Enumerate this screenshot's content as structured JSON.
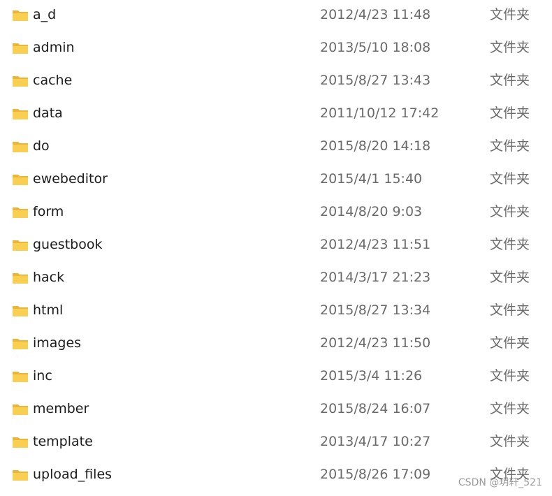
{
  "files": [
    {
      "name": "a_d",
      "modified": "2012/4/23 11:48",
      "type": "文件夹",
      "icon": "folder-icon"
    },
    {
      "name": "admin",
      "modified": "2013/5/10 18:08",
      "type": "文件夹",
      "icon": "folder-icon"
    },
    {
      "name": "cache",
      "modified": "2015/8/27 13:43",
      "type": "文件夹",
      "icon": "folder-icon"
    },
    {
      "name": "data",
      "modified": "2011/10/12 17:42",
      "type": "文件夹",
      "icon": "folder-icon"
    },
    {
      "name": "do",
      "modified": "2015/8/20 14:18",
      "type": "文件夹",
      "icon": "folder-icon"
    },
    {
      "name": "ewebeditor",
      "modified": "2015/4/1 15:40",
      "type": "文件夹",
      "icon": "folder-icon"
    },
    {
      "name": "form",
      "modified": "2014/8/20 9:03",
      "type": "文件夹",
      "icon": "folder-icon"
    },
    {
      "name": "guestbook",
      "modified": "2012/4/23 11:51",
      "type": "文件夹",
      "icon": "folder-icon"
    },
    {
      "name": "hack",
      "modified": "2014/3/17 21:23",
      "type": "文件夹",
      "icon": "folder-icon"
    },
    {
      "name": "html",
      "modified": "2015/8/27 13:34",
      "type": "文件夹",
      "icon": "folder-icon"
    },
    {
      "name": "images",
      "modified": "2012/4/23 11:50",
      "type": "文件夹",
      "icon": "folder-icon"
    },
    {
      "name": "inc",
      "modified": "2015/3/4 11:26",
      "type": "文件夹",
      "icon": "folder-icon"
    },
    {
      "name": "member",
      "modified": "2015/8/24 16:07",
      "type": "文件夹",
      "icon": "folder-icon"
    },
    {
      "name": "template",
      "modified": "2013/4/17 10:27",
      "type": "文件夹",
      "icon": "folder-icon"
    },
    {
      "name": "upload_files",
      "modified": "2015/8/26 17:09",
      "type": "文件夹",
      "icon": "folder-icon"
    }
  ],
  "watermark": "CSDN @玥轩_521",
  "colors": {
    "folder_body": "#F8CF50",
    "folder_tab": "#E9B53A",
    "name_text": "#1b1b1b",
    "meta_text": "#6a6a6a"
  }
}
